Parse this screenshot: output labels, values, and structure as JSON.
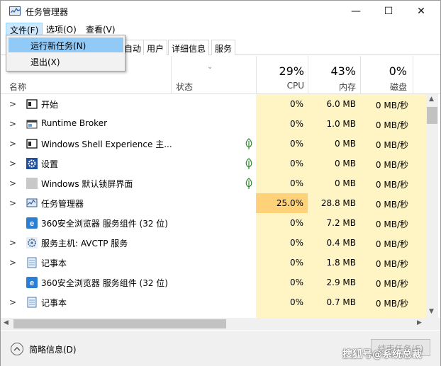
{
  "window": {
    "title": "任务管理器",
    "minimize": "—",
    "maximize": "☐",
    "close": "✕"
  },
  "menubar": {
    "file": "文件(F)",
    "options": "选项(O)",
    "view": "查看(V)"
  },
  "dropdown": {
    "run_new_task": "运行新任务(N)",
    "exit": "退出(X)"
  },
  "tabs": [
    "自动",
    "用户",
    "详细信息",
    "服务"
  ],
  "header": {
    "name": "名称",
    "status": "状态",
    "cpu_pct": "29%",
    "cpu_label": "CPU",
    "mem_pct": "43%",
    "mem_label": "内存",
    "disk_pct": "0%",
    "disk_label": "磁盘"
  },
  "colors": {
    "cpu_col": "#fff4c4",
    "cpu_hot": "#ffd27a",
    "accent": "#1e73be"
  },
  "processes": [
    {
      "name": "开始",
      "icon": "window-icon",
      "cpu": "0%",
      "mem": "6.0 MB",
      "disk": "0 MB/秒",
      "leaf": false,
      "chev": true
    },
    {
      "name": "Runtime Broker",
      "icon": "app-window-icon",
      "cpu": "0%",
      "mem": "1.0 MB",
      "disk": "0 MB/秒",
      "leaf": false,
      "chev": true
    },
    {
      "name": "Windows Shell Experience 主...",
      "icon": "window-icon",
      "cpu": "0%",
      "mem": "0 MB",
      "disk": "0 MB/秒",
      "leaf": true,
      "chev": true
    },
    {
      "name": "设置",
      "icon": "settings-gear-icon",
      "cpu": "0%",
      "mem": "0 MB",
      "disk": "0 MB/秒",
      "leaf": true,
      "chev": true
    },
    {
      "name": "Windows 默认锁屏界面",
      "icon": "gray-square-icon",
      "cpu": "0%",
      "mem": "0 MB",
      "disk": "0 MB/秒",
      "leaf": true,
      "chev": true
    },
    {
      "name": "任务管理器",
      "icon": "task-manager-icon",
      "cpu": "25.0%",
      "mem": "28.8 MB",
      "disk": "0 MB/秒",
      "leaf": false,
      "chev": true
    },
    {
      "name": "360安全浏览器 服务组件 (32 位)",
      "icon": "browser-360-icon",
      "cpu": "0%",
      "mem": "7.2 MB",
      "disk": "0 MB/秒",
      "leaf": false,
      "chev": false
    },
    {
      "name": "服务主机: AVCTP 服务",
      "icon": "service-gear-icon",
      "cpu": "0%",
      "mem": "0.4 MB",
      "disk": "0 MB/秒",
      "leaf": false,
      "chev": true
    },
    {
      "name": "记事本",
      "icon": "notepad-icon",
      "cpu": "0%",
      "mem": "1.8 MB",
      "disk": "0 MB/秒",
      "leaf": false,
      "chev": true
    },
    {
      "name": "360安全浏览器 服务组件 (32 位)",
      "icon": "browser-360-icon",
      "cpu": "0%",
      "mem": "2.9 MB",
      "disk": "0 MB/秒",
      "leaf": false,
      "chev": false
    },
    {
      "name": "记事本",
      "icon": "notepad-icon",
      "cpu": "0%",
      "mem": "0.7 MB",
      "disk": "0 MB/秒",
      "leaf": false,
      "chev": true
    }
  ],
  "footer": {
    "brief": "简略信息(D)",
    "end_task": "结束任务(E)"
  },
  "watermark": "搜狐号@系统总裁"
}
